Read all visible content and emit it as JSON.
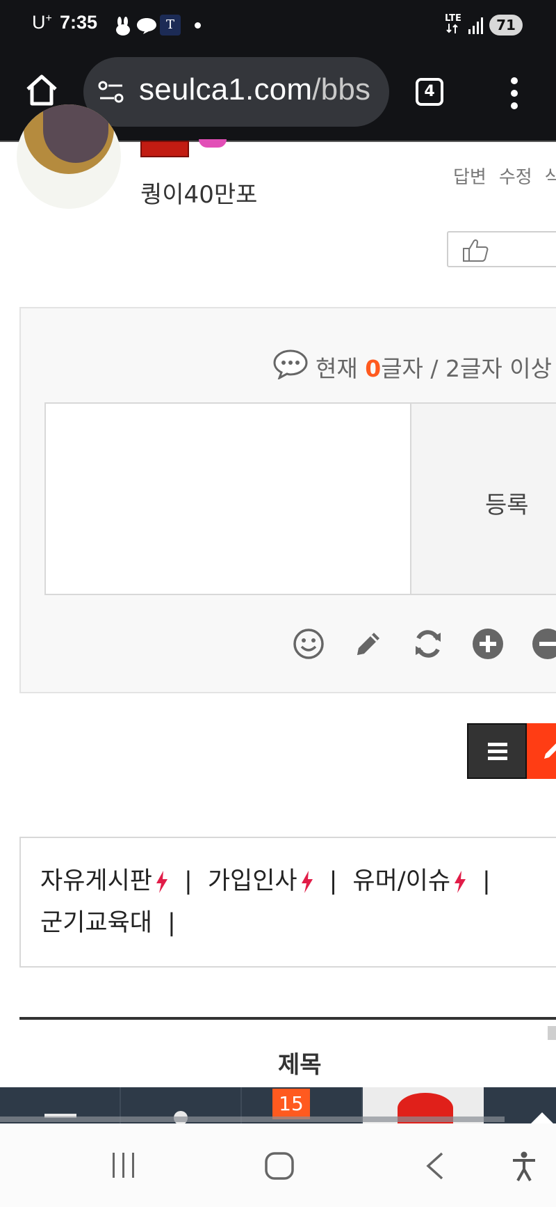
{
  "status_bar": {
    "carrier": "U",
    "carrier_sup": "+",
    "time": "7:35",
    "network": "LTE",
    "battery": "71"
  },
  "browser": {
    "url_main": "seulca1.com",
    "url_path": "/bbs",
    "tab_count": "4"
  },
  "post": {
    "author": "퀑이40만포",
    "actions": [
      "답변",
      "수정",
      "삭"
    ]
  },
  "comment": {
    "counter_prefix": "현재 ",
    "counter_value": "0",
    "counter_suffix": "글자 / 2글자 이상",
    "submit_label": "등록"
  },
  "boards": {
    "items": [
      "자유게시판",
      "가입인사",
      "유머/이슈",
      "군기교육대"
    ]
  },
  "table": {
    "col_title": "제목"
  },
  "banner": {
    "number": "15"
  },
  "colors": {
    "accent": "#ff5a1f",
    "bolt": "#e11d48",
    "dark": "#121316"
  }
}
